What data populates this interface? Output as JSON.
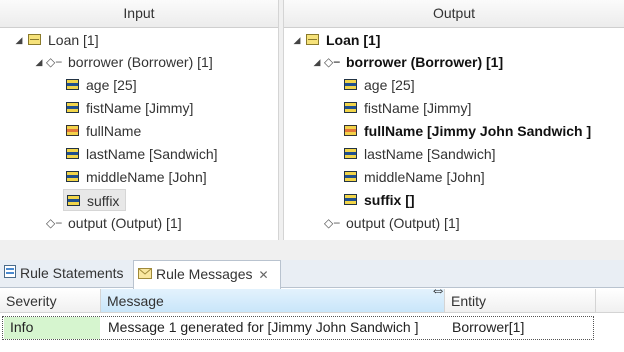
{
  "input_pane": {
    "title": "Input",
    "tree": [
      {
        "label": "Loan [1]",
        "icon": "entity-icon",
        "expanded": true,
        "bold": false
      },
      {
        "label": "borrower (Borrower) [1]",
        "icon": "association-icon",
        "expanded": true,
        "bold": false
      },
      {
        "label": "age [25]",
        "icon": "attribute-icon",
        "bold": false
      },
      {
        "label": "fistName [Jimmy]",
        "icon": "attribute-icon",
        "bold": false
      },
      {
        "label": "fullName",
        "icon": "attribute-orange-icon",
        "bold": false
      },
      {
        "label": "lastName [Sandwich]",
        "icon": "attribute-icon",
        "bold": false
      },
      {
        "label": "middleName [John]",
        "icon": "attribute-icon",
        "bold": false
      },
      {
        "label": "suffix",
        "icon": "attribute-icon",
        "bold": false,
        "selected": true
      },
      {
        "label": "output (Output) [1]",
        "icon": "association-icon",
        "bold": false
      }
    ]
  },
  "output_pane": {
    "title": "Output",
    "tree": [
      {
        "label": "Loan [1]",
        "icon": "entity-icon",
        "expanded": true,
        "bold": true
      },
      {
        "label": "borrower (Borrower) [1]",
        "icon": "association-icon",
        "expanded": true,
        "bold": true
      },
      {
        "label": "age [25]",
        "icon": "attribute-icon",
        "bold": false
      },
      {
        "label": "fistName [Jimmy]",
        "icon": "attribute-icon",
        "bold": false
      },
      {
        "label": "fullName [Jimmy John Sandwich ]",
        "icon": "attribute-orange-icon",
        "bold": true
      },
      {
        "label": "lastName [Sandwich]",
        "icon": "attribute-icon",
        "bold": false
      },
      {
        "label": "middleName [John]",
        "icon": "attribute-icon",
        "bold": false
      },
      {
        "label": "suffix []",
        "icon": "attribute-icon",
        "bold": true
      },
      {
        "label": "output (Output) [1]",
        "icon": "association-icon",
        "bold": false
      }
    ]
  },
  "tabs": [
    {
      "label": "Rule Statements",
      "icon": "rule-statements-icon",
      "active": false
    },
    {
      "label": "Rule Messages",
      "icon": "envelope-icon",
      "active": true,
      "close": "✕"
    }
  ],
  "messages_table": {
    "columns": [
      "Severity",
      "Message",
      "Entity"
    ],
    "rows": [
      {
        "severity": "Info",
        "message": "Message 1 generated for [Jimmy John Sandwich ]",
        "entity": "Borrower[1]"
      }
    ]
  },
  "colors": {
    "info_background": "#d6f5cf",
    "sorted_header": "#c9e6fa",
    "tab_bar": "#e9eef4"
  }
}
